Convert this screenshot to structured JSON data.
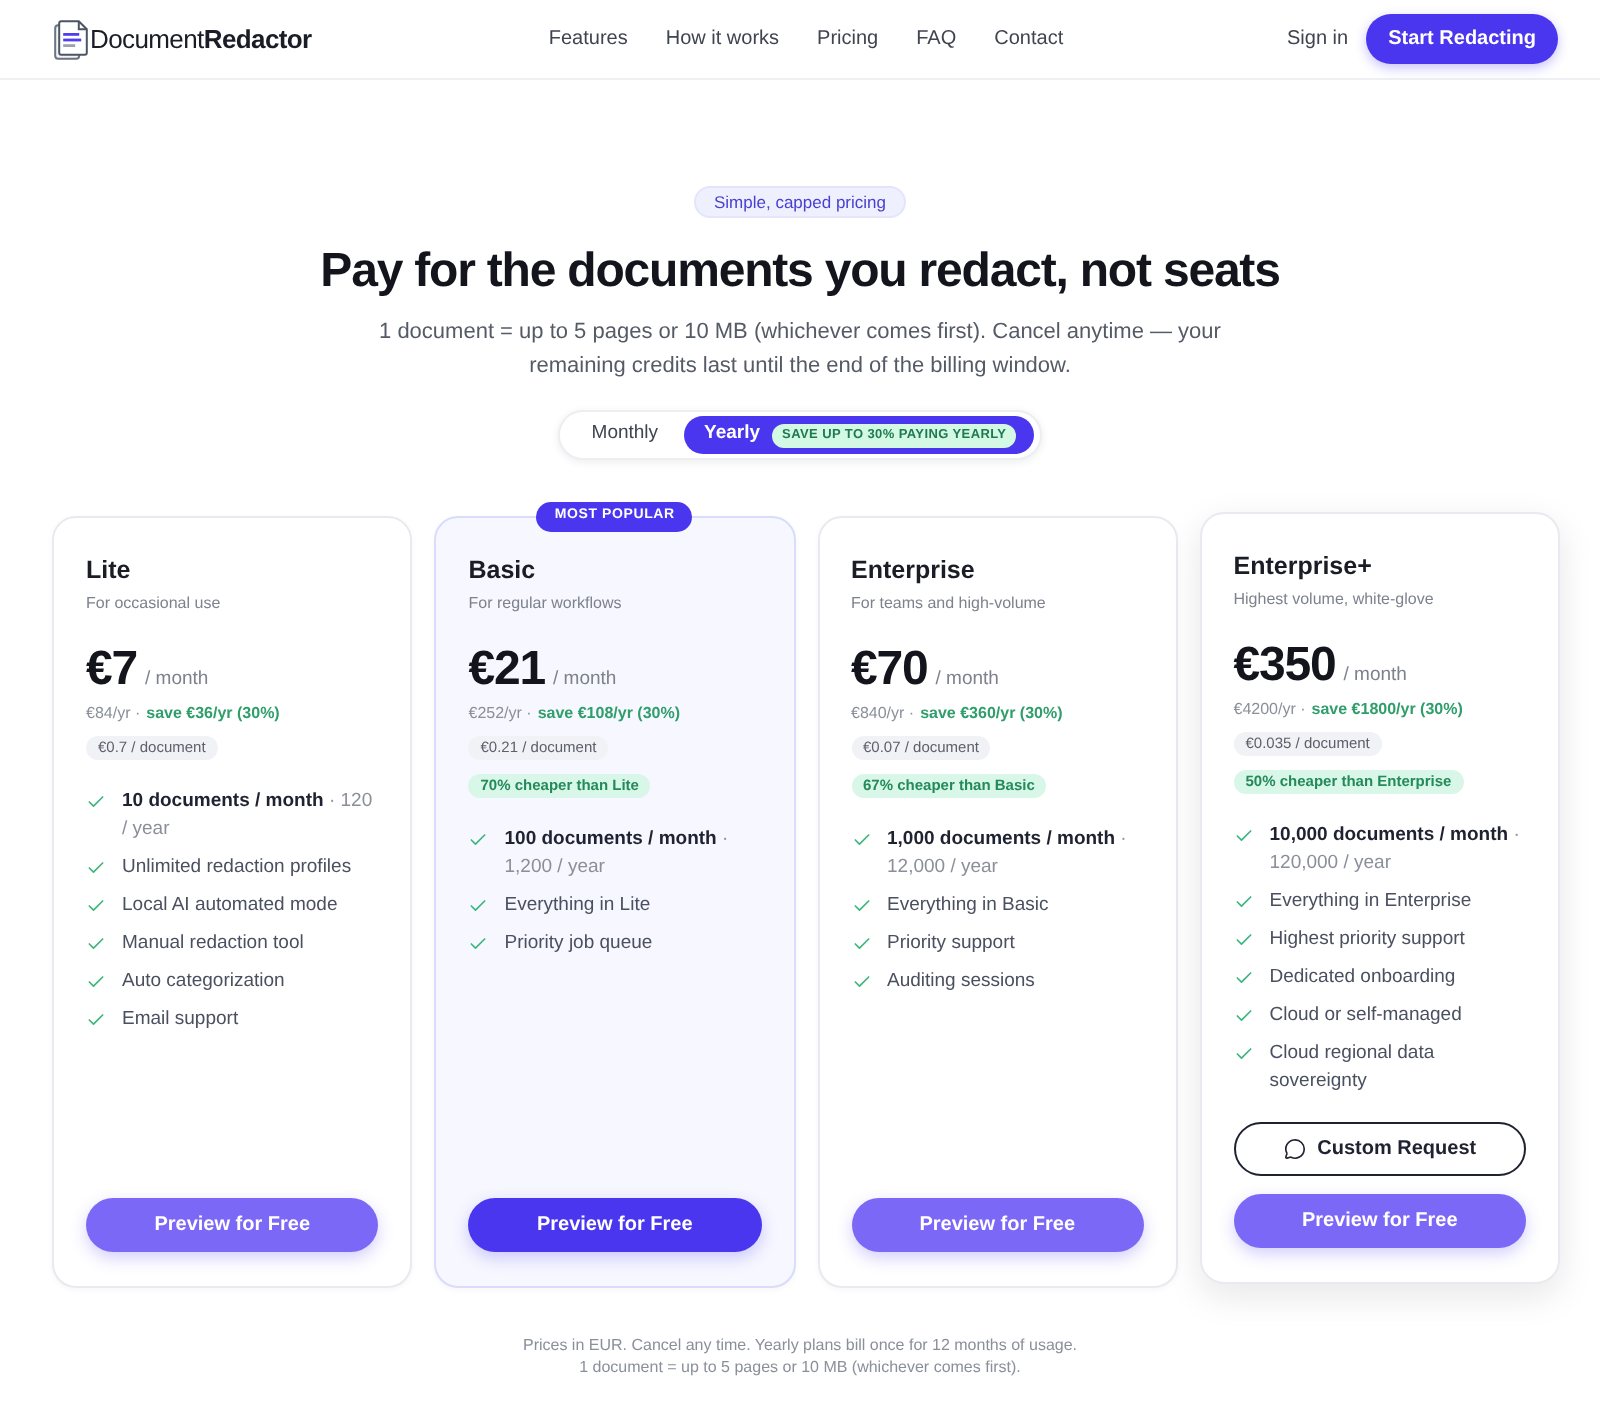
{
  "header": {
    "logo": "Document**Redactor**",
    "nav": [
      "Features",
      "How it works",
      "Pricing",
      "FAQ",
      "Contact"
    ],
    "sign_in": "Sign in",
    "cta": "Start Redacting"
  },
  "hero": {
    "badge": "Simple, capped pricing",
    "title": "Pay for the documents you redact, not seats",
    "subtitle": "1 document = up to 5 pages or 10 MB (whichever comes first). Cancel anytime — your remaining credits last until the end of the billing window."
  },
  "billing_toggle": {
    "options": [
      {
        "label": "Monthly",
        "selected": false
      },
      {
        "label": "Yearly",
        "selected": true,
        "badge": "SAVE UP TO 30% PAYING YEARLY"
      }
    ]
  },
  "plans": [
    {
      "name": "Lite",
      "tagline": "For occasional use",
      "price": "€7",
      "period": "/ month",
      "yearly_total": "€84/yr ·",
      "savings": "save €36/yr (30%)",
      "per_document": "€0.7 / document",
      "featured": false,
      "raised": false,
      "features": [
        {
          "kind": "quota",
          "text": "**10 documents / month** · 120 / year"
        },
        {
          "kind": "feature",
          "text": "Unlimited redaction profiles"
        },
        {
          "kind": "feature",
          "text": "Local AI automated mode"
        },
        {
          "kind": "feature",
          "text": "Manual redaction tool"
        },
        {
          "kind": "feature",
          "text": "Auto categorization"
        },
        {
          "kind": "feature",
          "text": "Email support"
        }
      ],
      "buttons": [
        {
          "kind": "primary",
          "label": "Preview for Free"
        }
      ]
    },
    {
      "name": "Basic",
      "tagline": "For regular workflows",
      "price": "€21",
      "period": "/ month",
      "yearly_total": "€252/yr ·",
      "savings": "save €108/yr (30%)",
      "per_document": "€0.21 / document",
      "comparison": "70% cheaper than Lite",
      "featured": true,
      "raised": false,
      "ribbon": "MOST POPULAR",
      "features": [
        {
          "kind": "quota",
          "text": "**100 documents / month** · 1,200 / year"
        },
        {
          "kind": "feature",
          "text": "Everything in Lite"
        },
        {
          "kind": "feature",
          "text": "Priority job queue"
        }
      ],
      "buttons": [
        {
          "kind": "primary",
          "label": "Preview for Free"
        }
      ]
    },
    {
      "name": "Enterprise",
      "tagline": "For teams and high-volume",
      "price": "€70",
      "period": "/ month",
      "yearly_total": "€840/yr ·",
      "savings": "save €360/yr (30%)",
      "per_document": "€0.07 / document",
      "comparison": "67% cheaper than Basic",
      "featured": false,
      "raised": false,
      "features": [
        {
          "kind": "quota",
          "text": "**1,000 documents / month** · 12,000 / year"
        },
        {
          "kind": "feature",
          "text": "Everything in Basic"
        },
        {
          "kind": "feature",
          "text": "Priority support"
        },
        {
          "kind": "feature",
          "text": "Auditing sessions"
        }
      ],
      "buttons": [
        {
          "kind": "primary",
          "label": "Preview for Free"
        }
      ]
    },
    {
      "name": "Enterprise+",
      "tagline": "Highest volume, white-glove",
      "price": "€350",
      "period": "/ month",
      "yearly_total": "€4200/yr ·",
      "savings": "save €1800/yr (30%)",
      "per_document": "€0.035 / document",
      "comparison": "50% cheaper than Enterprise",
      "featured": false,
      "raised": true,
      "features": [
        {
          "kind": "quota",
          "text": "**10,000 documents / month** · 120,000 / year"
        },
        {
          "kind": "feature",
          "text": "Everything in Enterprise"
        },
        {
          "kind": "feature",
          "text": "Highest priority support"
        },
        {
          "kind": "feature",
          "text": "Dedicated onboarding"
        },
        {
          "kind": "feature",
          "text": "Cloud or self-managed"
        },
        {
          "kind": "feature",
          "text": "Cloud regional data sovereignty"
        }
      ],
      "buttons": [
        {
          "kind": "outline",
          "label": "Custom Request"
        },
        {
          "kind": "primary",
          "label": "Preview for Free"
        }
      ]
    }
  ],
  "footer_note": [
    "Prices in EUR. Cancel any time. Yearly plans bill once for 12 months of usage.",
    "1 document = up to 5 pages or 10 MB (whichever comes first)."
  ]
}
